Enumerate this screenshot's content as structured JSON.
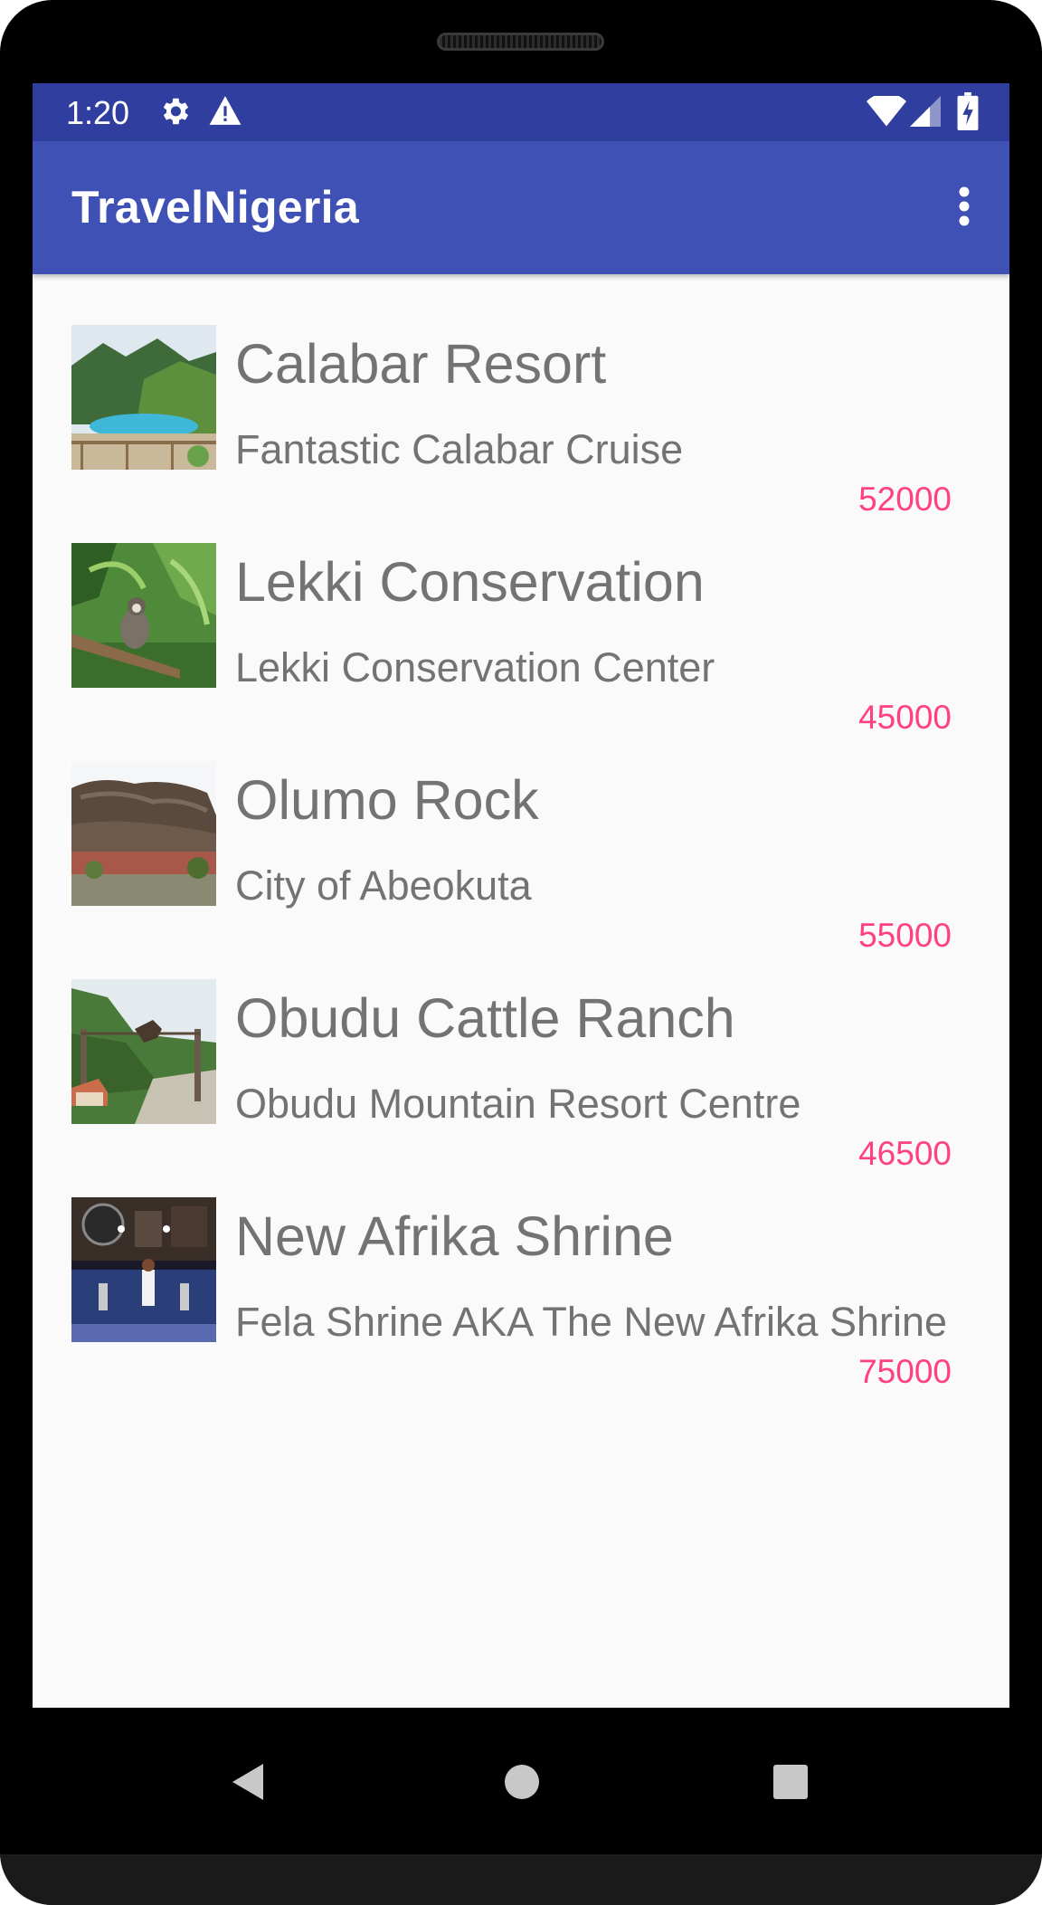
{
  "status_bar": {
    "time": "1:20",
    "icons": [
      "settings-gear-icon",
      "warning-icon",
      "wifi-icon",
      "cell-signal-icon",
      "battery-charging-icon"
    ]
  },
  "app_bar": {
    "title": "TravelNigeria",
    "menu_icon": "overflow-menu-icon"
  },
  "destinations": [
    {
      "title": "Calabar Resort",
      "subtitle": "Fantastic Calabar Cruise",
      "price": "52000",
      "thumb": "resort-pool-image"
    },
    {
      "title": "Lekki Conservation",
      "subtitle": "Lekki Conservation Center",
      "price": "45000",
      "thumb": "monkey-forest-image"
    },
    {
      "title": "Olumo Rock",
      "subtitle": "City of Abeokuta",
      "price": "55000",
      "thumb": "rock-formation-image"
    },
    {
      "title": "Obudu Cattle Ranch",
      "subtitle": "Obudu Mountain Resort Centre",
      "price": "46500",
      "thumb": "ranch-gate-image"
    },
    {
      "title": "New Afrika Shrine",
      "subtitle": "Fela Shrine AKA The New Afrika Shrine",
      "price": "75000",
      "thumb": "concert-stage-image"
    }
  ],
  "nav_bar": {
    "buttons": [
      "back-icon",
      "home-icon",
      "recents-icon"
    ]
  },
  "colors": {
    "status_bar": "#303f9f",
    "app_bar": "#3f51b5",
    "accent": "#ff4081",
    "text": "#737373",
    "background": "#fafafa"
  }
}
